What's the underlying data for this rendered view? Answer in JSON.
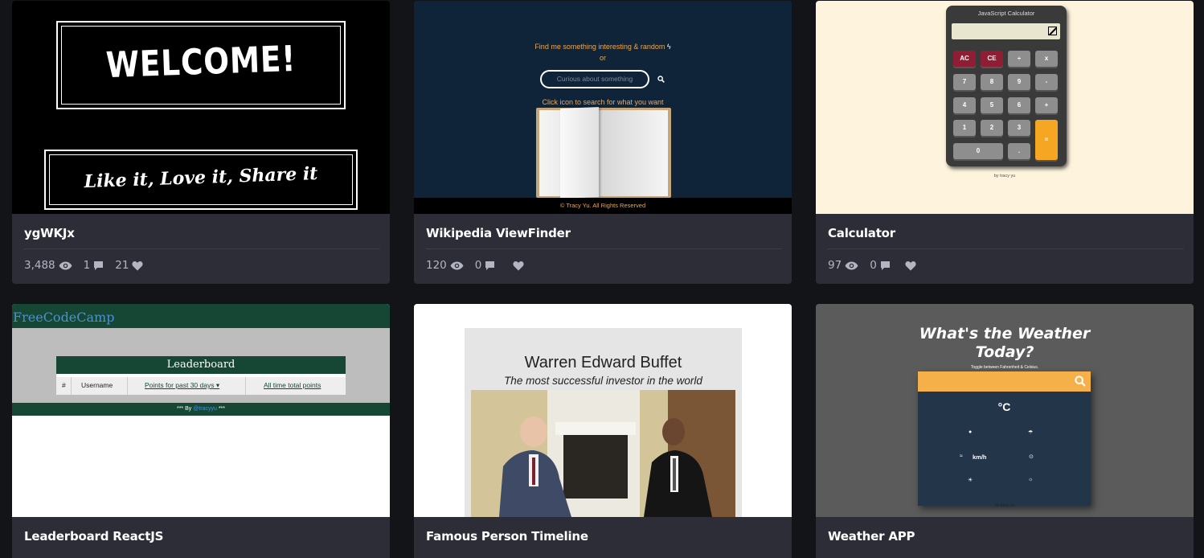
{
  "cards": [
    {
      "title": "ygWKJx",
      "views": "3,488",
      "comments": "1",
      "likes": "21",
      "thumb": {
        "welcome": "WELCOME!",
        "share": "Like it, Love it, Share it"
      }
    },
    {
      "title": "Wikipedia ViewFinder",
      "views": "120",
      "comments": "0",
      "likes": "",
      "thumb": {
        "find": "Find me something interesting & random",
        "or": "or",
        "search_placeholder": "Curious about something",
        "click": "Click icon to search for what you want",
        "footer": "© Tracy Yu. All Rights Reserved"
      }
    },
    {
      "title": "Calculator",
      "views": "97",
      "comments": "0",
      "likes": "",
      "thumb": {
        "calc_title": "JavaScript Calculator",
        "keys": [
          "AC",
          "CE",
          "÷",
          "x",
          "7",
          "8",
          "9",
          "-",
          "4",
          "5",
          "6",
          "+",
          "1",
          "2",
          "3",
          "=",
          "0",
          "."
        ],
        "by": "by tracy yu"
      }
    },
    {
      "title": "Leaderboard ReactJS",
      "thumb": {
        "brand": "FreeCodeCamp",
        "heading": "Leaderboard",
        "col_num": "#",
        "col_user": "Username",
        "col_30": "Points for past 30 days ▾",
        "col_all": "All time total points",
        "by_prefix": "*** By ",
        "by_link": "@tracyyu",
        "by_suffix": " ***"
      }
    },
    {
      "title": "Famous Person Timeline",
      "thumb": {
        "name": "Warren Edward Buffet",
        "subtitle": "The most successful investor in the world"
      }
    },
    {
      "title": "Weather APP",
      "thumb": {
        "title_line1": "What's the Weather",
        "title_line2": "Today?",
        "toggle": "Toggle between Fahrenheit & Celsius.",
        "unit": "°C",
        "wind_unit": "km/h",
        "by": "by tracy yu"
      }
    }
  ],
  "colors": {
    "page_bg": "#131417",
    "card_bg": "#2c2d36",
    "stat_text": "#b3b6c2",
    "accent_orange": "#f0a64d",
    "fcc_green": "#154734"
  }
}
